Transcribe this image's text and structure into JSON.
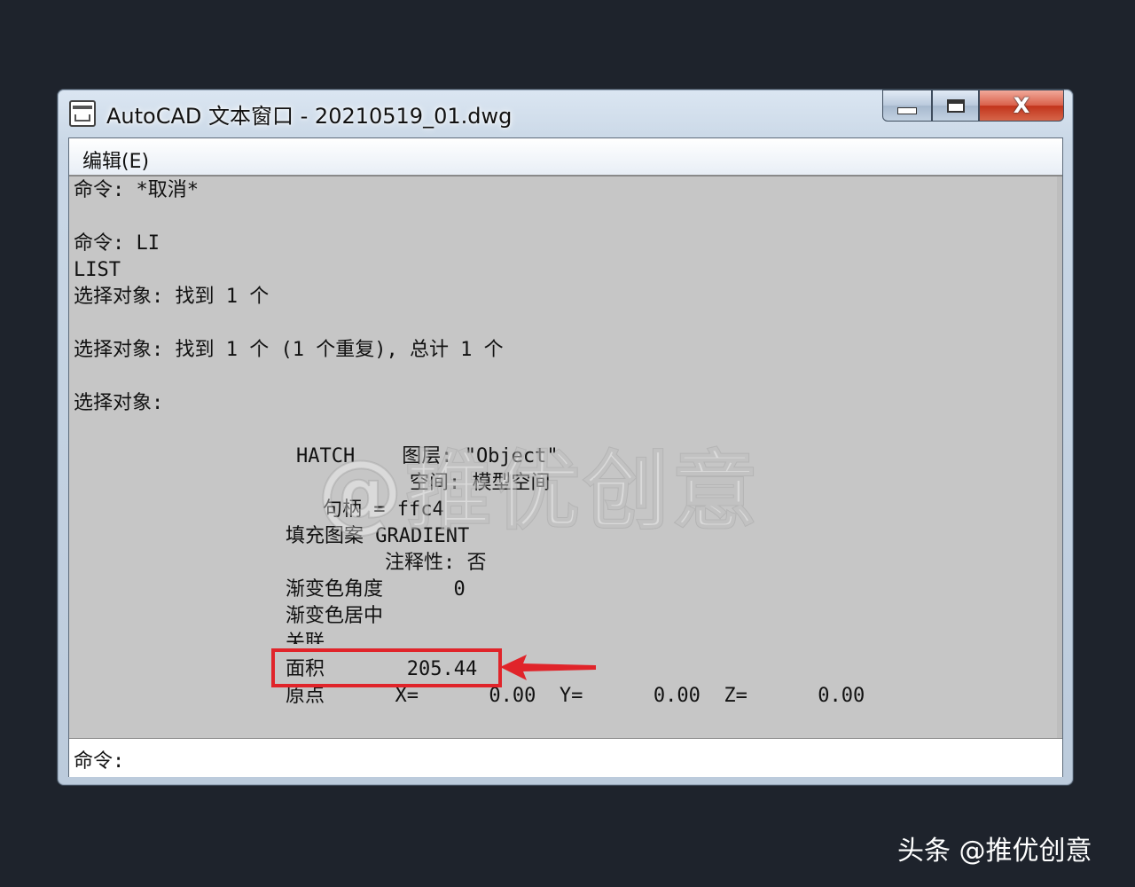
{
  "window": {
    "title": "AutoCAD 文本窗口 - 20210519_01.dwg",
    "buttons": {
      "minimize": "minimize",
      "maximize": "maximize",
      "close": "X"
    }
  },
  "menu": {
    "edit": "编辑(E)"
  },
  "output_lines": {
    "l1": "命令: *取消*",
    "l2": "命令: LI",
    "l3": "LIST",
    "l4": "选择对象: 找到 1 个",
    "l5": "选择对象: 找到 1 个 (1 个重复), 总计 1 个",
    "l6": "选择对象:",
    "l7": "HATCH    图层: \"Object\"",
    "l8": "空间: 模型空间",
    "l9": "句柄 = ffc4",
    "l10": "填充图案 GRADIENT",
    "l11": "注释性: 否",
    "l12": "渐变色角度      0",
    "l13": "渐变色居中",
    "l14": "关联",
    "l15": "面积       205.44",
    "l16": "原点      X=      0.00  Y=      0.00  Z=      0.00"
  },
  "command_line": {
    "prompt": "命令:"
  },
  "watermarks": {
    "center": "@推优创意",
    "footer": "头条 @推优创意"
  },
  "colors": {
    "highlight": "#e0242a",
    "background": "#1e232c"
  }
}
